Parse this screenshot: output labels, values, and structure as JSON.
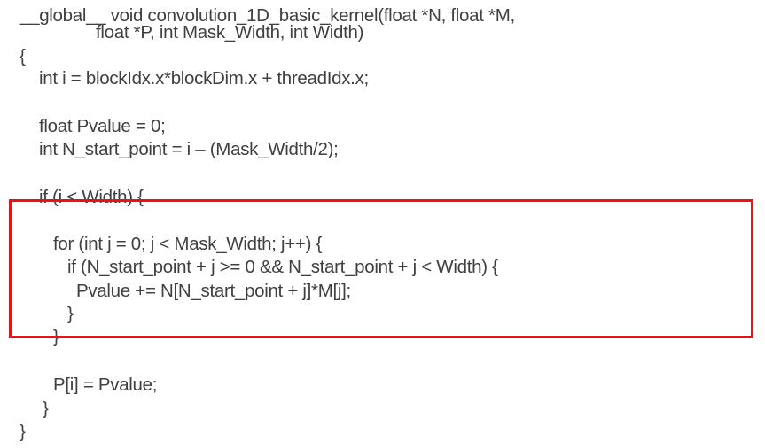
{
  "code": {
    "lines": [
      "__global__ void convolution_1D_basic_kernel(float *N, float *M,",
      "float *P, int Mask_Width, int Width)",
      "{",
      "int i = blockIdx.x*blockDim.x + threadIdx.x;",
      "float Pvalue = 0;",
      "int N_start_point = i – (Mask_Width/2);",
      "if (i < Width) {",
      "for (int j = 0; j < Mask_Width; j++) {",
      "if (N_start_point + j >= 0 && N_start_point + j < Width) {",
      "Pvalue += N[N_start_point + j]*M[j];",
      "}",
      "}",
      "P[i] = Pvalue;",
      "}",
      "}"
    ]
  },
  "colors": {
    "text": "#404040",
    "highlight_border": "#ee1111"
  }
}
